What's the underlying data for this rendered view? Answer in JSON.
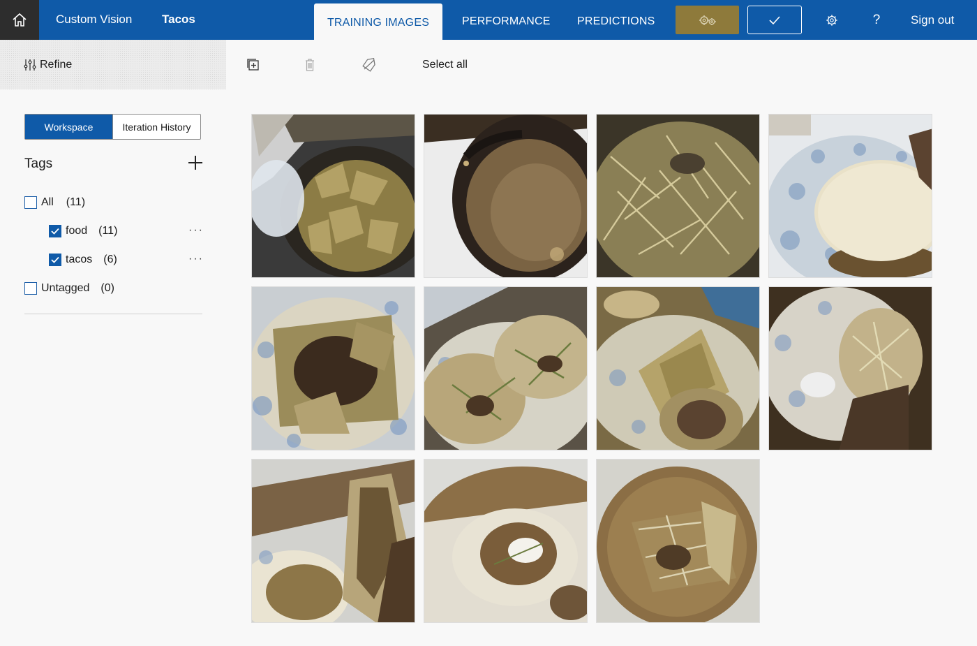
{
  "header": {
    "brand": "Custom Vision",
    "project": "Tacos",
    "tabs": [
      {
        "label": "TRAINING IMAGES",
        "active": true
      },
      {
        "label": "PERFORMANCE",
        "active": false
      },
      {
        "label": "PREDICTIONS",
        "active": false
      }
    ],
    "sign_out": "Sign out",
    "icons": {
      "home": "home-icon",
      "train": "gears-icon",
      "quick_test": "checkmark-icon",
      "settings": "gear-icon",
      "help": "question-icon"
    },
    "colors": {
      "bar": "#0f5aa8",
      "train_button": "#8e7a3b"
    }
  },
  "commandbar": {
    "refine_label": "Refine",
    "select_all": "Select all",
    "icons": [
      "add-images-icon",
      "delete-icon",
      "tag-icon"
    ]
  },
  "sidebar": {
    "segments": [
      {
        "label": "Workspace",
        "active": true
      },
      {
        "label": "Iteration History",
        "active": false
      }
    ],
    "tags_title": "Tags",
    "tags": [
      {
        "label": "All",
        "count": "(11)",
        "checked": false
      },
      {
        "label": "food",
        "count": "(11)",
        "checked": true
      },
      {
        "label": "tacos",
        "count": "(6)",
        "checked": true
      },
      {
        "label": "Untagged",
        "count": "(0)",
        "checked": false
      }
    ],
    "more_label": "···"
  },
  "images": [
    {
      "name": "chips-in-basket"
    },
    {
      "name": "bean-dip-bowl"
    },
    {
      "name": "shredded-cheese"
    },
    {
      "name": "tortilla-on-plate"
    },
    {
      "name": "nachos-plate"
    },
    {
      "name": "tacos-plate"
    },
    {
      "name": "hard-shell-tacos"
    },
    {
      "name": "taco-closeup"
    },
    {
      "name": "taco-held"
    },
    {
      "name": "tostada-sour-cream"
    },
    {
      "name": "taco-on-plate"
    }
  ]
}
